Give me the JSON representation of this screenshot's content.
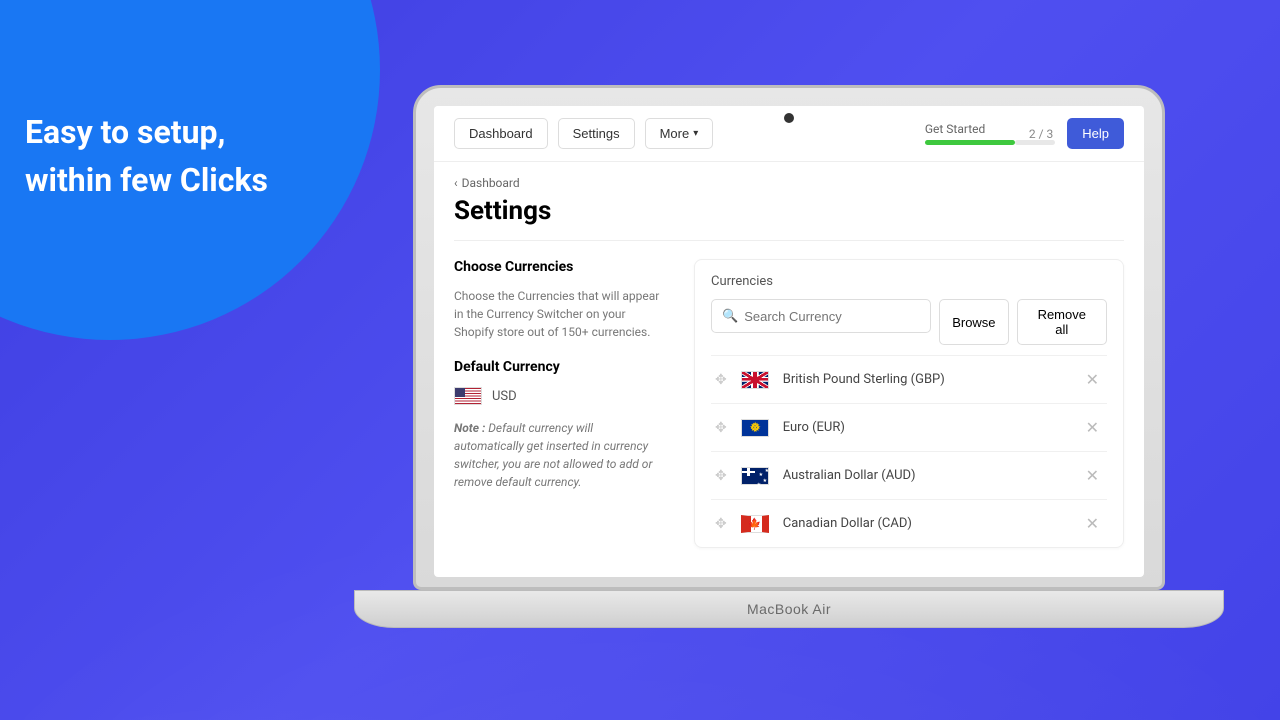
{
  "promo": {
    "line1": "Easy to setup,",
    "line2": "within few Clicks"
  },
  "device_label": "MacBook Air",
  "topbar": {
    "dashboard": "Dashboard",
    "settings": "Settings",
    "more": "More",
    "get_started": "Get Started",
    "step": "2 / 3",
    "help": "Help"
  },
  "breadcrumb": "Dashboard",
  "page_title": "Settings",
  "left": {
    "choose_title": "Choose Currencies",
    "choose_desc": "Choose the Currencies that will appear in the Currency Switcher on your Shopify store out of 150+ currencies.",
    "default_title": "Default Currency",
    "default_code": "USD",
    "note_label": "Note :",
    "note_text": " Default currency will automatically get inserted in currency switcher, you are not allowed to add or remove default currency."
  },
  "panel": {
    "title": "Currencies",
    "search_placeholder": "Search Currency",
    "browse": "Browse",
    "remove_all": "Remove all",
    "items": [
      {
        "name": "British Pound Sterling (GBP)",
        "flag": "gb"
      },
      {
        "name": "Euro (EUR)",
        "flag": "eu"
      },
      {
        "name": "Australian Dollar (AUD)",
        "flag": "au"
      },
      {
        "name": "Canadian Dollar (CAD)",
        "flag": "ca"
      }
    ]
  }
}
